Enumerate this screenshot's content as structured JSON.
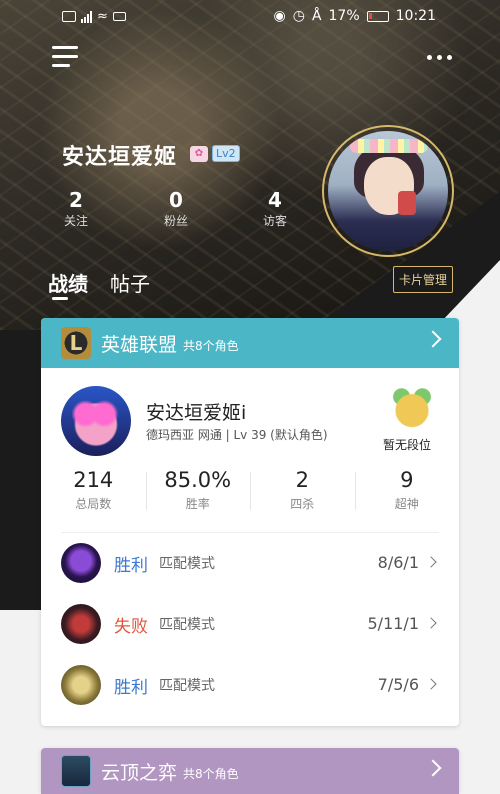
{
  "status_bar": {
    "battery": "17%",
    "time": "10:21",
    "left_icons": [
      "hd-icon",
      "signal-icon",
      "wifi-icon",
      "video-icon"
    ]
  },
  "profile": {
    "username": "安达垣爱姬",
    "level_badge": "Lv2",
    "stats": [
      {
        "value": "2",
        "label": "关注"
      },
      {
        "value": "0",
        "label": "粉丝"
      },
      {
        "value": "4",
        "label": "访客"
      }
    ]
  },
  "tabs": [
    {
      "label": "战绩",
      "active": true
    },
    {
      "label": "帖子",
      "active": false
    }
  ],
  "card_manage": "卡片管理",
  "lol": {
    "title": "英雄联盟",
    "subtitle": "共8个角色",
    "role_name": "安达垣爱姬i",
    "role_meta": "德玛西亚 网通 | Lv 39 (默认角色)",
    "rank": "暂无段位",
    "stats": [
      {
        "value": "214",
        "label": "总局数"
      },
      {
        "value": "85.0%",
        "label": "胜率"
      },
      {
        "value": "2",
        "label": "四杀"
      },
      {
        "value": "9",
        "label": "超神"
      }
    ],
    "matches": [
      {
        "result": "胜利",
        "mode": "匹配模式",
        "kda": "8/6/1",
        "win": true
      },
      {
        "result": "失败",
        "mode": "匹配模式",
        "kda": "5/11/1",
        "win": false
      },
      {
        "result": "胜利",
        "mode": "匹配模式",
        "kda": "7/5/6",
        "win": true
      }
    ]
  },
  "tft": {
    "title": "云顶之弈",
    "subtitle": "共8个角色"
  },
  "colors": {
    "lol_header": "#4bb6c6",
    "tft_header": "#b296c2",
    "win": "#3c7ad0",
    "lose": "#e0553d",
    "gold": "#d7b86a"
  }
}
